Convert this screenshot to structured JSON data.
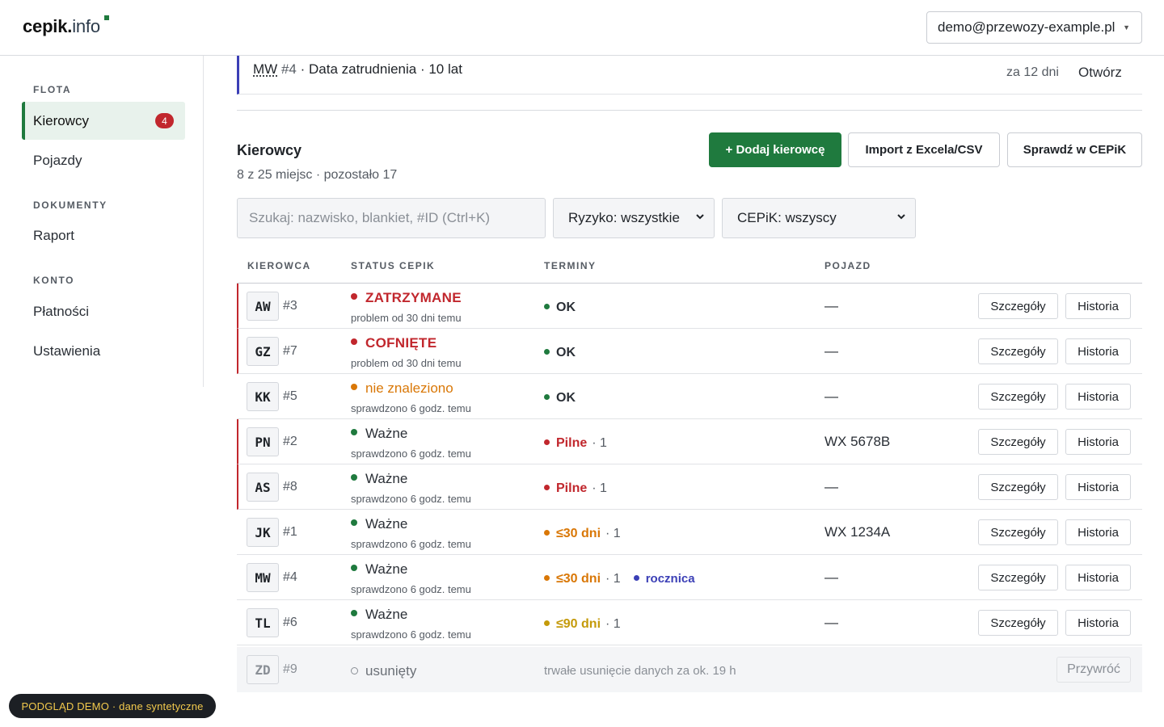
{
  "brand": {
    "name": "cepik",
    "dot": ".",
    "tld": "info"
  },
  "account": {
    "email": "demo@przewozy-example.pl"
  },
  "sidebar": {
    "sections": [
      {
        "label": "FLOTA"
      },
      {
        "label": "DOKUMENTY"
      },
      {
        "label": "KONTO"
      }
    ],
    "items": [
      {
        "label": "Kierowcy",
        "badge": "4",
        "active": true
      },
      {
        "label": "Pojazdy"
      },
      {
        "label": "Raport"
      },
      {
        "label": "Płatności"
      },
      {
        "label": "Ustawienia"
      }
    ]
  },
  "notice": {
    "abbr": "MW",
    "id": "#4",
    "text": "· Data zatrudnienia · 10 lat",
    "when": "za 12 dni",
    "open_label": "Otwórz"
  },
  "section": {
    "title": "Kierowcy",
    "subtitle": "8 z 25 miejsc · pozostało 17",
    "add_label": "+ Dodaj kierowcę",
    "import_label": "Import z Excela/CSV",
    "check_label": "Sprawdź w CEPiK"
  },
  "filters": {
    "search_placeholder": "Szukaj: nazwisko, blankiet, #ID (Ctrl+K)",
    "risk_value": "Ryzyko: wszystkie",
    "cepik_value": "CEPiK: wszyscy"
  },
  "table": {
    "headers": [
      "KIEROWCA",
      "STATUS CEPIK",
      "TERMINY",
      "POJAZD"
    ],
    "details_label": "Szczegóły",
    "history_label": "Historia",
    "rows": [
      {
        "initials": "AW",
        "id": "#3",
        "status": "ZATRZYMANE",
        "status_sub": "problem od 30 dni temu",
        "term": "OK",
        "term_count": "",
        "term_extra": "",
        "vehicle": "—"
      },
      {
        "initials": "GZ",
        "id": "#7",
        "status": "COFNIĘTE",
        "status_sub": "problem od 30 dni temu",
        "term": "OK",
        "term_count": "",
        "term_extra": "",
        "vehicle": "—"
      },
      {
        "initials": "KK",
        "id": "#5",
        "status": "nie znaleziono",
        "status_sub": "sprawdzono 6 godz. temu",
        "term": "OK",
        "term_count": "",
        "term_extra": "",
        "vehicle": "—"
      },
      {
        "initials": "PN",
        "id": "#2",
        "status": "Ważne",
        "status_sub": "sprawdzono 6 godz. temu",
        "term": "Pilne",
        "term_count": "· 1",
        "term_extra": "",
        "vehicle": "WX 5678B"
      },
      {
        "initials": "AS",
        "id": "#8",
        "status": "Ważne",
        "status_sub": "sprawdzono 6 godz. temu",
        "term": "Pilne",
        "term_count": "· 1",
        "term_extra": "",
        "vehicle": "—"
      },
      {
        "initials": "JK",
        "id": "#1",
        "status": "Ważne",
        "status_sub": "sprawdzono 6 godz. temu",
        "term": "≤30 dni",
        "term_count": "· 1",
        "term_extra": "",
        "vehicle": "WX 1234A"
      },
      {
        "initials": "MW",
        "id": "#4",
        "status": "Ważne",
        "status_sub": "sprawdzono 6 godz. temu",
        "term": "≤30 dni",
        "term_count": "· 1",
        "term_extra": "rocznica",
        "vehicle": "—"
      },
      {
        "initials": "TL",
        "id": "#6",
        "status": "Ważne",
        "status_sub": "sprawdzono 6 godz. temu",
        "term": "≤90 dni",
        "term_count": "· 1",
        "term_extra": "",
        "vehicle": "—"
      }
    ],
    "deleted_row": {
      "initials": "ZD",
      "id": "#9",
      "status": "usunięty",
      "note": "trwałe usunięcie danych za ok. 19 h",
      "restore_label": "Przywróć"
    }
  },
  "demo_badge": "PODGLĄD DEMO · dane syntetyczne",
  "colors": {
    "brand_green": "#1f7a3e",
    "danger_red": "#c1272d",
    "warning_orange": "#d97706",
    "caution_gold": "#c49a0a",
    "ok_green": "#1f7a3e",
    "info_indigo": "#3b3fb6"
  }
}
